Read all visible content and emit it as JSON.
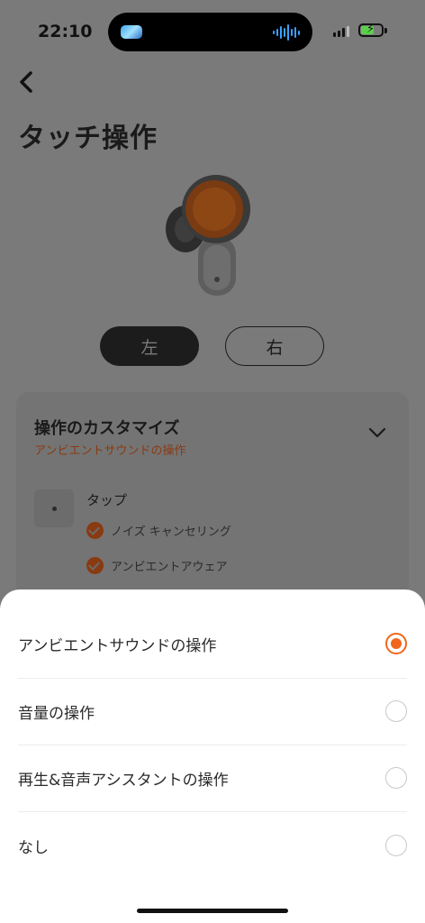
{
  "status_bar": {
    "time": "22:10"
  },
  "page": {
    "title": "タッチ操作",
    "sides": {
      "left": "左",
      "right": "右"
    },
    "card": {
      "title": "操作のカスタマイズ",
      "subtitle": "アンビエントサウンドの操作",
      "tap_label": "タップ",
      "options": [
        "ノイズ キャンセリング",
        "アンビエントアウェア"
      ]
    }
  },
  "sheet": {
    "options": [
      {
        "label": "アンビエントサウンドの操作",
        "selected": true
      },
      {
        "label": "音量の操作",
        "selected": false
      },
      {
        "label": "再生&音声アシスタントの操作",
        "selected": false
      },
      {
        "label": "なし",
        "selected": false
      }
    ]
  },
  "colors": {
    "accent": "#f0661b",
    "overlay": "#7a7a7a"
  }
}
